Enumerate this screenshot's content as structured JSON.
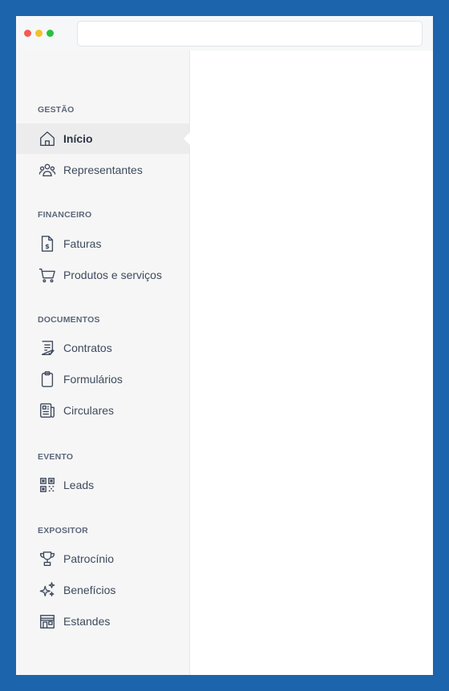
{
  "sidebar": {
    "sections": {
      "gestao": "GESTÃO",
      "financeiro": "FINANCEIRO",
      "documentos": "DOCUMENTOS",
      "evento": "EVENTO",
      "expositor": "EXPOSITOR"
    },
    "items": [
      {
        "label": "Início",
        "icon": "home-icon",
        "active": true
      },
      {
        "label": "Representantes",
        "icon": "users-icon"
      },
      {
        "label": "Faturas",
        "icon": "invoice-icon"
      },
      {
        "label": "Produtos e serviços",
        "icon": "cart-icon"
      },
      {
        "label": "Contratos",
        "icon": "contract-icon"
      },
      {
        "label": "Formulários",
        "icon": "clipboard-icon"
      },
      {
        "label": "Circulares",
        "icon": "newspaper-icon"
      },
      {
        "label": "Leads",
        "icon": "qr-code-icon"
      },
      {
        "label": "Patrocínio",
        "icon": "trophy-icon"
      },
      {
        "label": "Benefícios",
        "icon": "sparkles-icon"
      },
      {
        "label": "Estandes",
        "icon": "store-icon"
      }
    ]
  },
  "colors": {
    "background": "#1c64ab",
    "sidebar": "#f6f6f7",
    "active_item": "#ececed",
    "text": "#3e4a5b",
    "section_text": "#5c6778"
  }
}
